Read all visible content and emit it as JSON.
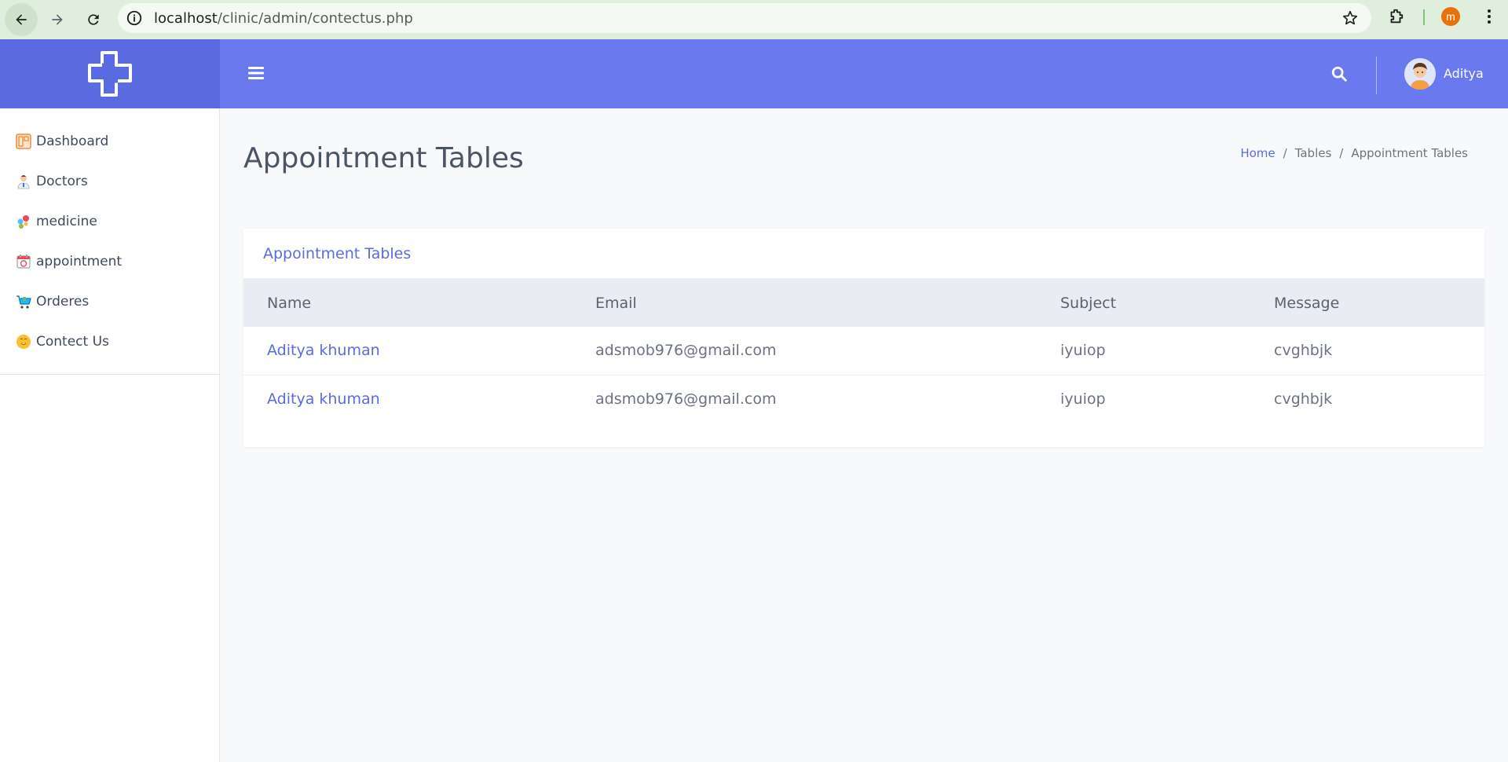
{
  "browser": {
    "url_host": "localhost",
    "url_path": "/clinic/admin/contectus.php",
    "profile_initial": "m"
  },
  "sidebar": {
    "items": [
      {
        "label": "Dashboard",
        "icon": "dashboard-icon"
      },
      {
        "label": "Doctors",
        "icon": "doctor-icon"
      },
      {
        "label": "medicine",
        "icon": "medicine-icon"
      },
      {
        "label": "appointment",
        "icon": "appointment-icon"
      },
      {
        "label": "Orderes",
        "icon": "cart-icon"
      },
      {
        "label": "Contect Us",
        "icon": "contact-icon"
      }
    ]
  },
  "topbar": {
    "username": "Aditya"
  },
  "page": {
    "title": "Appointment Tables",
    "breadcrumb": [
      "Home",
      "Tables",
      "Appointment Tables"
    ]
  },
  "card": {
    "title": "Appointment Tables",
    "columns": [
      "Name",
      "Email",
      "Subject",
      "Message"
    ],
    "rows": [
      [
        "Aditya khuman",
        "adsmob976@gmail.com",
        "iyuiop",
        "cvghbjk"
      ],
      [
        "Aditya khuman",
        "adsmob976@gmail.com",
        "iyuiop",
        "cvghbjk"
      ]
    ]
  },
  "colors": {
    "topbar": "#6a79ee",
    "logo_bg": "#5a6be2",
    "accent": "#5a6be2"
  }
}
